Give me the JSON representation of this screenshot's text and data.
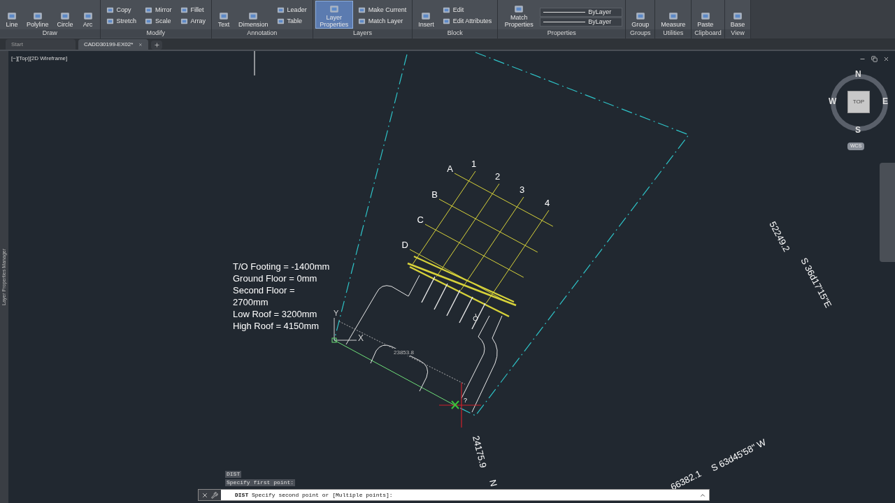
{
  "ribbon": {
    "panels": [
      {
        "title": "Draw",
        "tools": [
          {
            "kind": "large",
            "label": "Line",
            "selected": false
          },
          {
            "kind": "large",
            "label": "Polyline",
            "selected": false
          },
          {
            "kind": "large",
            "label": "Circle",
            "selected": false
          },
          {
            "kind": "large",
            "label": "Arc",
            "selected": false
          }
        ]
      },
      {
        "title": "Modify",
        "tools": [
          {
            "kind": "small",
            "label": "Copy",
            "selected": false
          },
          {
            "kind": "small",
            "label": "Stretch",
            "selected": false
          },
          {
            "kind": "small",
            "label": "Mirror",
            "selected": false
          },
          {
            "kind": "small",
            "label": "Scale",
            "selected": false
          },
          {
            "kind": "small",
            "label": "Fillet",
            "selected": false
          },
          {
            "kind": "small",
            "label": "Array",
            "selected": false
          }
        ]
      },
      {
        "title": "Annotation",
        "tools": [
          {
            "kind": "large",
            "label": "Text",
            "selected": false
          },
          {
            "kind": "large",
            "label": "Dimension",
            "selected": false
          },
          {
            "kind": "small",
            "label": "Leader",
            "selected": false
          },
          {
            "kind": "small",
            "label": "Table",
            "selected": false
          }
        ]
      },
      {
        "title": "Layers",
        "tools": [
          {
            "kind": "large",
            "label": "Layer Properties",
            "selected": true
          },
          {
            "kind": "small",
            "label": "Make Current",
            "selected": false
          },
          {
            "kind": "small",
            "label": "Match Layer",
            "selected": false
          }
        ]
      },
      {
        "title": "Block",
        "tools": [
          {
            "kind": "large",
            "label": "Insert",
            "selected": false
          },
          {
            "kind": "small",
            "label": "Edit",
            "selected": false
          },
          {
            "kind": "small",
            "label": "Edit Attributes",
            "selected": false
          }
        ]
      },
      {
        "title": "Properties",
        "tools": [
          {
            "kind": "large",
            "label": "Match Properties",
            "selected": false
          },
          {
            "kind": "dropdown",
            "label": "ByLayer",
            "selected": false
          },
          {
            "kind": "dropdown",
            "label": "ByLayer",
            "selected": false
          }
        ]
      },
      {
        "title": "Groups",
        "tools": [
          {
            "kind": "large",
            "label": "Group",
            "selected": false
          }
        ]
      },
      {
        "title": "Utilities",
        "tools": [
          {
            "kind": "large",
            "label": "Measure",
            "selected": false
          }
        ]
      },
      {
        "title": "Clipboard",
        "tools": [
          {
            "kind": "large",
            "label": "Paste",
            "selected": false
          }
        ]
      },
      {
        "title": "View",
        "tools": [
          {
            "kind": "large",
            "label": "Base",
            "selected": false
          }
        ]
      }
    ]
  },
  "tabs": [
    {
      "label": "Start",
      "selected": false
    },
    {
      "label": "CADD30199-EX02*",
      "selected": true
    }
  ],
  "viewport": {
    "controls_label": "[−][Top][2D Wireframe]",
    "side_palette": "Layer Properties Manager",
    "viewcube": {
      "face": "TOP",
      "north": "N",
      "east": "E",
      "south": "S",
      "west": "W",
      "ucs": "WCS"
    },
    "drawing": {
      "grid_rows": [
        "A",
        "B",
        "C",
        "D"
      ],
      "grid_columns": [
        "1",
        "2",
        "3",
        "4"
      ],
      "notes": [
        "T/O Footing = -1400mm",
        "Ground Floor = 0mm",
        "Second Floor =",
        "2700mm",
        "Low Roof = 3200mm",
        "High Roof = 4150mm"
      ],
      "ucs": {
        "x": "X",
        "y": "Y"
      },
      "measurement": "23853.8",
      "cursor_hint": "?",
      "annotations": [
        "52249.2",
        "S 36d17'15\"E",
        "24175.9",
        "N",
        "66382.1",
        "S 63d45'58\" W"
      ]
    }
  },
  "command": {
    "history": [
      "DIST",
      "Specify first point:"
    ],
    "prompt": "**DIST** Specify second point or [Multiple points]:"
  }
}
